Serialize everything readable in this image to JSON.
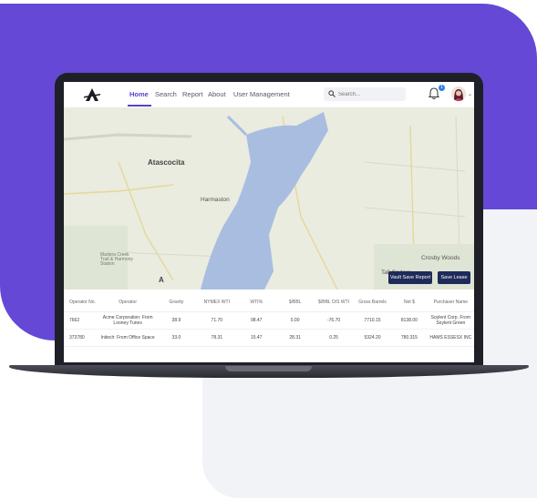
{
  "colors": {
    "accent": "#5b3fd0",
    "purple_background": "#6548d6",
    "button": "#1e2a5a",
    "badge": "#2f7de1"
  },
  "nav": {
    "logo": "logo-icon",
    "items": [
      {
        "label": "Home",
        "active": true
      },
      {
        "label": "Search"
      },
      {
        "label": "Report"
      },
      {
        "label": "About"
      },
      {
        "label": "User Management"
      }
    ],
    "search_placeholder": "Search...",
    "notification_count": "1"
  },
  "map": {
    "labels": {
      "atascocita": "Atascocita",
      "harmaston": "Harmaston",
      "crosby_woods": "Crosby Woods",
      "tall_cedars": "Tall Cedars",
      "marker": "A",
      "trail": "Madera Creek\nTrail & Harmony\nStation"
    },
    "buttons": {
      "vault": "Vault Save Report",
      "save_lease": "Save Lease"
    }
  },
  "table": {
    "columns": [
      "Operator No.",
      "Operator",
      "Gravity",
      "NYMEX WTI",
      "WTI%",
      "$/BBL",
      "$/BBL O/S WTI",
      "Gross Barrels",
      "Net $",
      "Purchaser Name"
    ],
    "rows": [
      [
        "7662",
        "Acme Corporation: From Looney Tunes",
        "38.9",
        "71.70",
        "98.47",
        "0.00",
        "-76.70",
        "7710.15",
        "8138.00",
        "Soylent Corp. From Soylent Green"
      ],
      [
        "373780",
        "Initech: From Office Space",
        "33.0",
        "78.31",
        "15.47",
        "28.31",
        "0.25",
        "5324.20",
        "780.315",
        "HAMS ESSESX INC"
      ]
    ]
  }
}
